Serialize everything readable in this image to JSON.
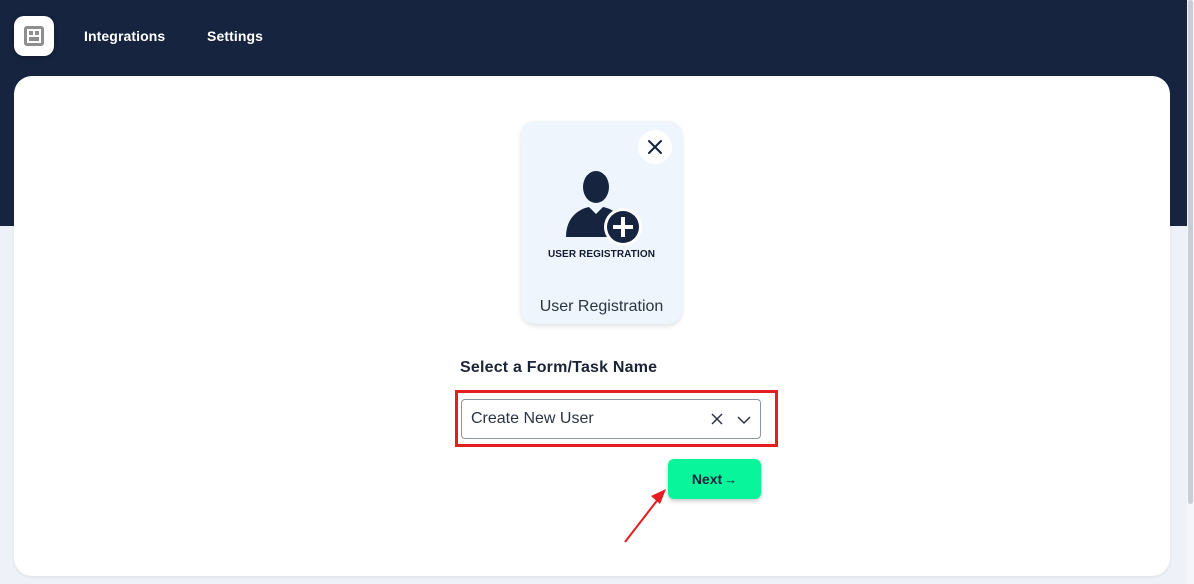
{
  "nav": {
    "logo": "app-logo-icon",
    "links": [
      "Integrations",
      "Settings"
    ]
  },
  "card": {
    "icon": "user-add-icon",
    "icon_caption": "USER REGISTRATION",
    "title": "User Registration",
    "close_icon": "close-icon"
  },
  "form": {
    "label": "Select a Form/Task Name",
    "select_value": "Create New User",
    "clear_icon": "clear-icon",
    "dropdown_icon": "chevron-down-icon"
  },
  "actions": {
    "next_label": "Next",
    "next_arrow": "→"
  },
  "colors": {
    "header_bg": "#16243f",
    "accent_button": "#08f59b",
    "annotation_red": "#e41d20"
  }
}
